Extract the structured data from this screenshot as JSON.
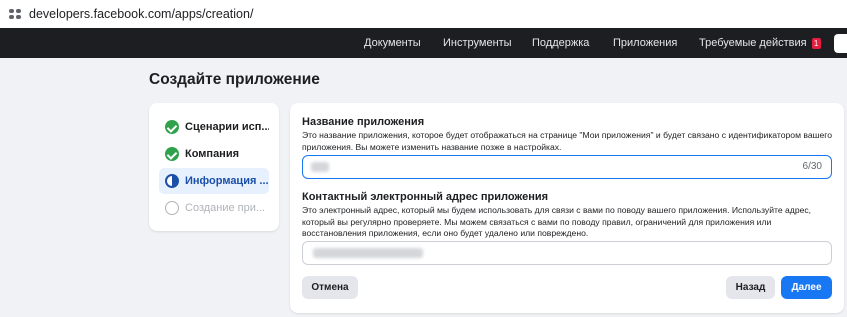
{
  "browser": {
    "url": "developers.facebook.com/apps/creation/"
  },
  "nav": {
    "items": [
      "Документы",
      "Инструменты",
      "Поддержка",
      "Приложения",
      "Требуемые действия"
    ],
    "badge_count": "1"
  },
  "page": {
    "title": "Создайте приложение"
  },
  "steps": [
    {
      "label": "Сценарии исп...",
      "state": "done"
    },
    {
      "label": "Компания",
      "state": "done"
    },
    {
      "label": "Информация ...",
      "state": "active"
    },
    {
      "label": "Создание при...",
      "state": "pending"
    }
  ],
  "form": {
    "app_name": {
      "label": "Название приложения",
      "description": "Это название приложения, которое будет отображаться на странице \"Мои приложения\" и будет связано с идентификатором вашего приложения. Вы можете изменить название позже в настройках.",
      "counter": "6/30"
    },
    "contact_email": {
      "label": "Контактный электронный адрес приложения",
      "description": "Это электронный адрес, который мы будем использовать для связи с вами по поводу вашего приложения. Используйте адрес, который вы регулярно проверяете. Мы можем связаться с вами по поводу правил, ограничений для приложения или восстановления приложения, если оно будет удалено или повреждено."
    },
    "buttons": {
      "cancel": "Отмена",
      "back": "Назад",
      "next": "Далее"
    }
  },
  "colors": {
    "nav_bg": "#1c1e21",
    "primary": "#1877f2",
    "success": "#31a24c",
    "active_step": "#1b4fa8"
  }
}
